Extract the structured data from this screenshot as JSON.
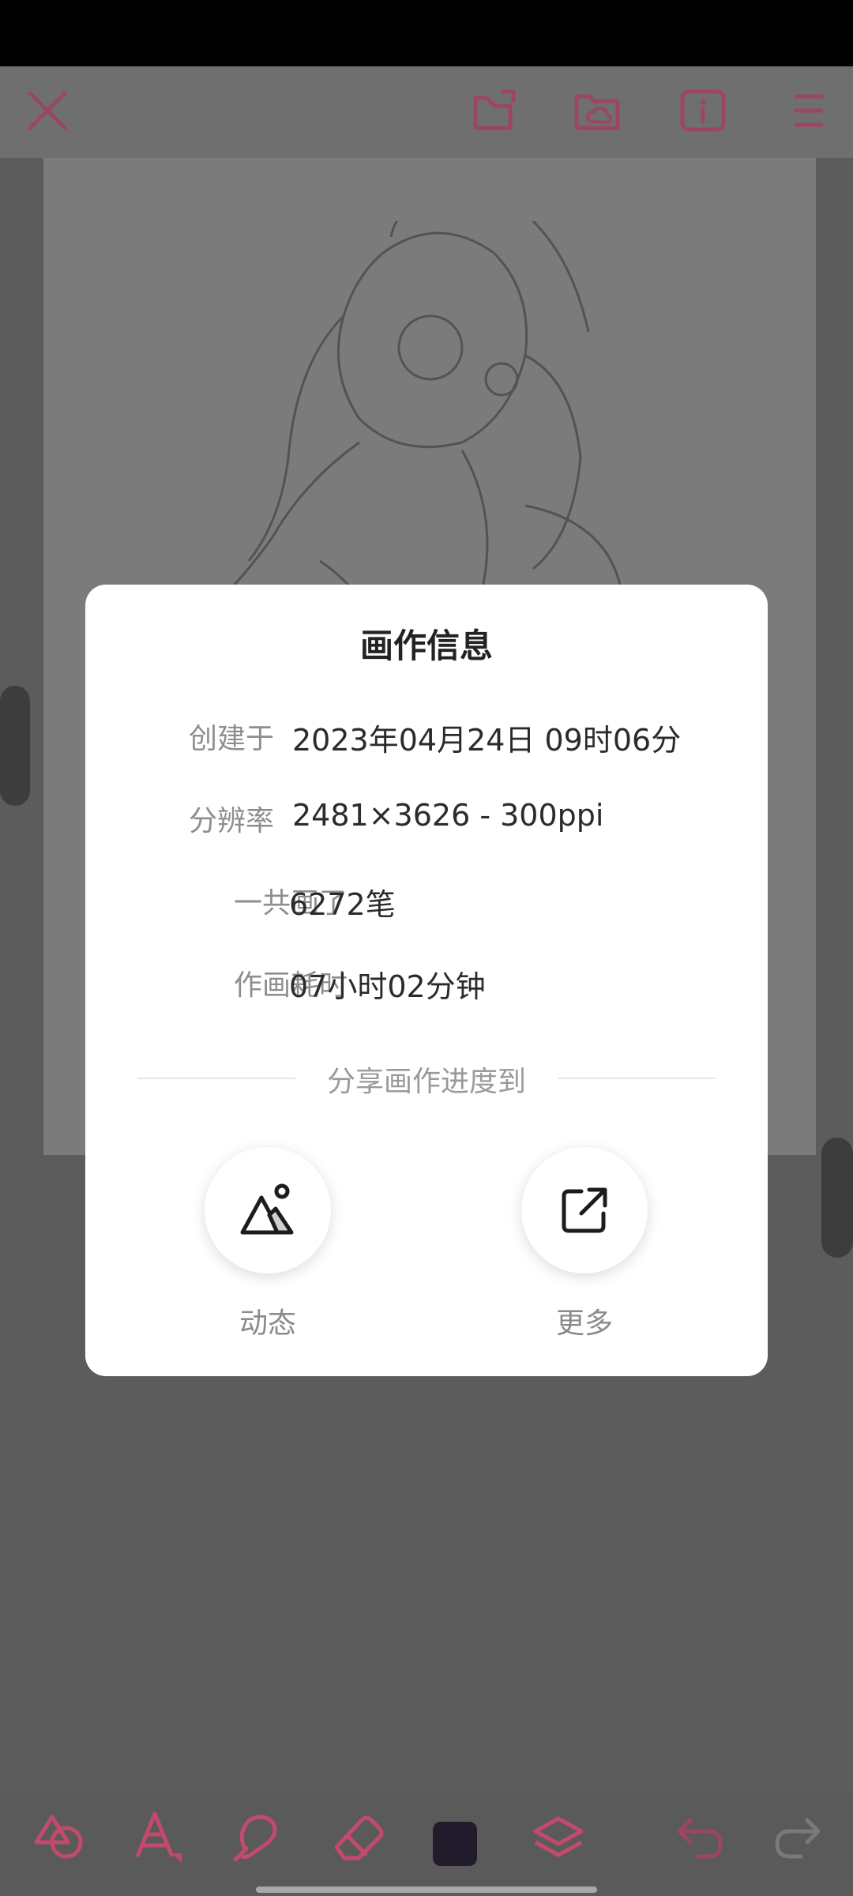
{
  "colors": {
    "accent": "#c34a6c",
    "accent_dim": "#9d4660",
    "swatch": "#211b2c"
  },
  "toolbar": {
    "icons": [
      "close-icon",
      "canvas-edit-icon",
      "cloud-folder-icon",
      "info-icon",
      "menu-icon"
    ]
  },
  "dialog": {
    "title": "画作信息",
    "rows": [
      {
        "label": "创建于",
        "value": "2023年04月24日 09时06分"
      },
      {
        "label": "分辨率",
        "value": "2481×3626 - 300ppi"
      },
      {
        "label": "一共画了",
        "value": "6272笔"
      },
      {
        "label": "作画耗时",
        "value": "07小时02分钟"
      }
    ],
    "share_heading": "分享画作进度到",
    "share_buttons": [
      {
        "label": "动态",
        "icon": "mountain-image-icon"
      },
      {
        "label": "更多",
        "icon": "external-link-icon"
      }
    ]
  },
  "bottom_toolbar": {
    "icons": [
      "shapes-icon",
      "brush-icon",
      "smudge-icon",
      "eraser-icon",
      "color-swatch",
      "layers-icon",
      "undo-icon",
      "redo-icon"
    ]
  }
}
